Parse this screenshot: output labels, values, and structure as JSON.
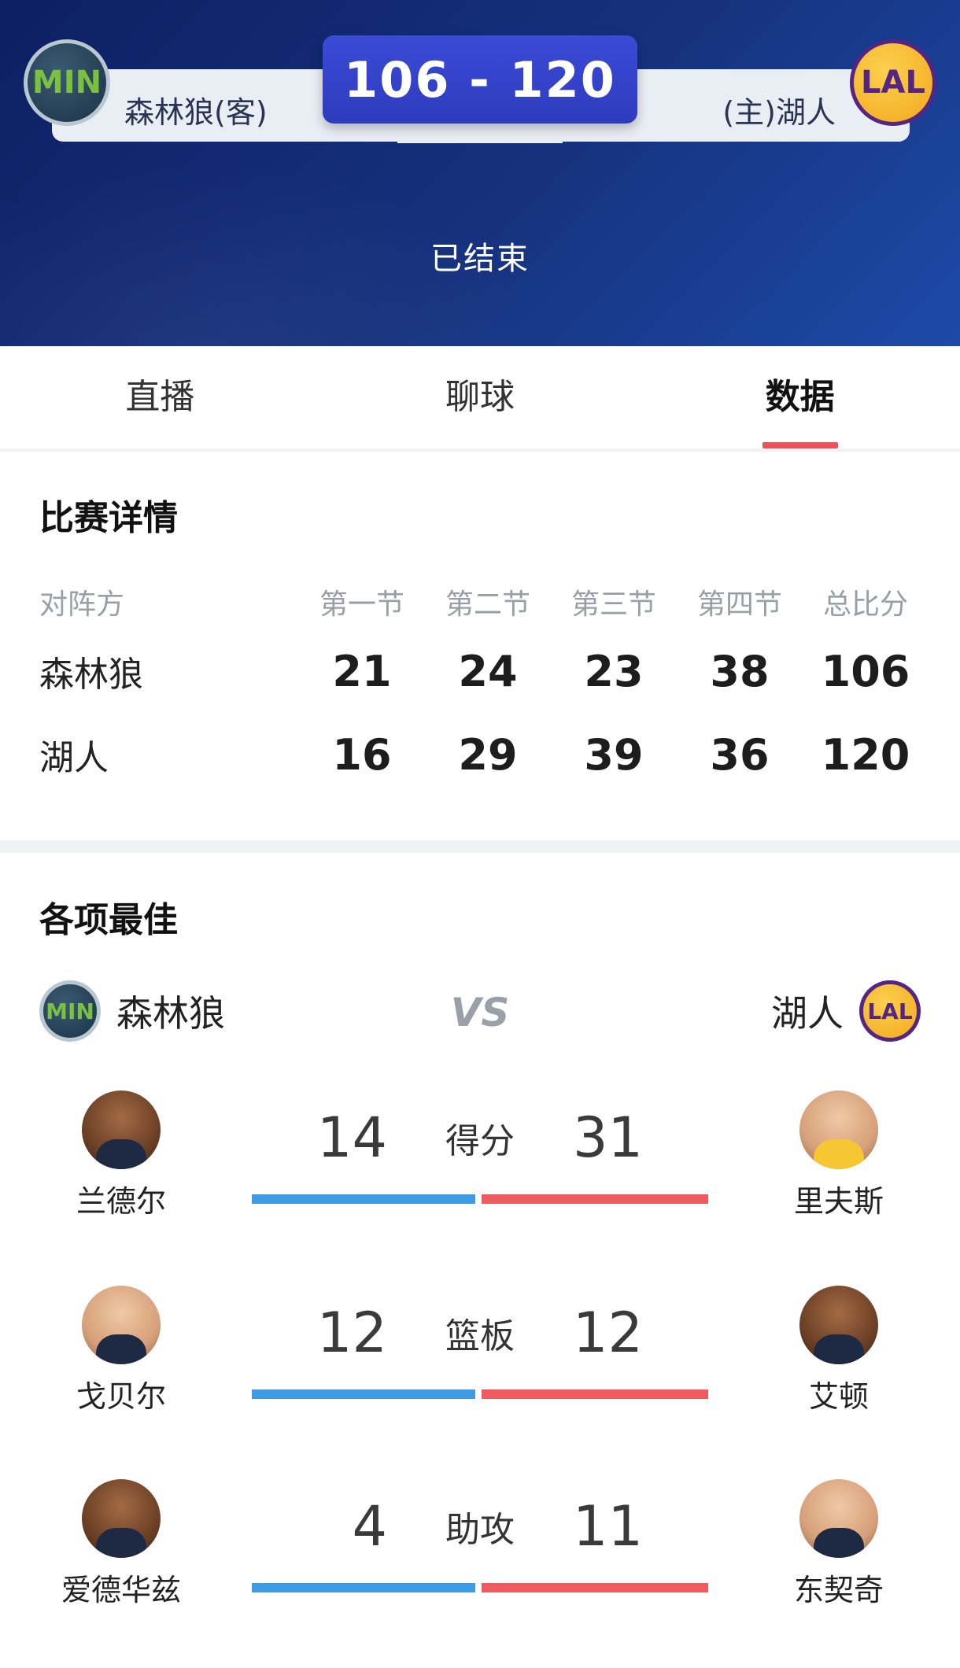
{
  "header": {
    "away_team": "森林狼(客)",
    "home_team": "(主)湖人",
    "score": "106 - 120",
    "status": "已结束",
    "away_logo_text": "MIN",
    "home_logo_text": "LAL"
  },
  "tabs": [
    {
      "label": "直播",
      "active": false
    },
    {
      "label": "聊球",
      "active": false
    },
    {
      "label": "数据",
      "active": true
    }
  ],
  "match_details": {
    "title": "比赛详情",
    "columns": [
      "对阵方",
      "第一节",
      "第二节",
      "第三节",
      "第四节",
      "总比分"
    ],
    "rows": [
      {
        "team": "森林狼",
        "q1": "21",
        "q2": "24",
        "q3": "23",
        "q4": "38",
        "total": "106"
      },
      {
        "team": "湖人",
        "q1": "16",
        "q2": "29",
        "q3": "39",
        "q4": "36",
        "total": "120"
      }
    ]
  },
  "leaders": {
    "title": "各项最佳",
    "left_team": "森林狼",
    "right_team": "湖人",
    "vs": "VS",
    "categories": [
      {
        "label": "得分",
        "left_player": "兰德尔",
        "left_value": "14",
        "right_player": "里夫斯",
        "right_value": "31"
      },
      {
        "label": "篮板",
        "left_player": "戈贝尔",
        "left_value": "12",
        "right_player": "艾顿",
        "right_value": "12"
      },
      {
        "label": "助攻",
        "left_player": "爱德华兹",
        "left_value": "4",
        "right_player": "东契奇",
        "right_value": "11"
      }
    ]
  },
  "colors": {
    "header_bg": "#16327e",
    "score_box": "#3344c8",
    "tab_indicator": "#e9535a",
    "away_bar": "#3d9be3",
    "home_bar": "#ef5a5e"
  }
}
